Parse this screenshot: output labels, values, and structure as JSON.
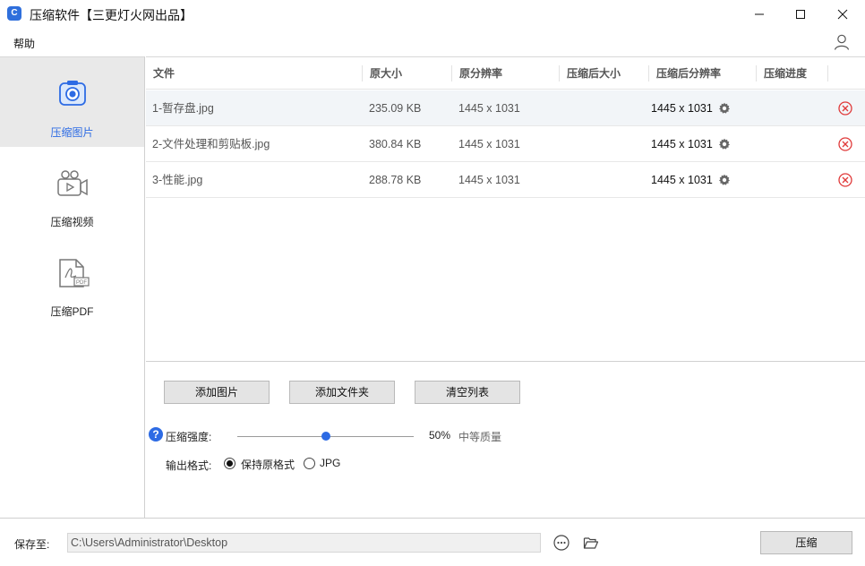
{
  "window": {
    "app_icon_letter": "C",
    "title": "压缩软件【三更灯火网出品】"
  },
  "menu": {
    "help": "帮助"
  },
  "sidebar": {
    "items": [
      {
        "label": "压缩图片",
        "icon": "image-compress-icon",
        "active": true
      },
      {
        "label": "压缩视频",
        "icon": "video-camera-icon",
        "active": false
      },
      {
        "label": "压缩PDF",
        "icon": "pdf-file-icon",
        "active": false
      }
    ]
  },
  "table": {
    "headers": [
      "文件",
      "原大小",
      "原分辨率",
      "压缩后大小",
      "压缩后分辨率",
      "压缩进度"
    ],
    "rows": [
      {
        "file": "1-暂存盘.jpg",
        "size": "235.09 KB",
        "resolution": "1445 x 1031",
        "compressed_size": "",
        "compressed_resolution": "1445 x 1031",
        "progress": ""
      },
      {
        "file": "2-文件处理和剪贴板.jpg",
        "size": "380.84 KB",
        "resolution": "1445 x 1031",
        "compressed_size": "",
        "compressed_resolution": "1445 x 1031",
        "progress": ""
      },
      {
        "file": "3-性能.jpg",
        "size": "288.78 KB",
        "resolution": "1445 x 1031",
        "compressed_size": "",
        "compressed_resolution": "1445 x 1031",
        "progress": ""
      }
    ]
  },
  "controls": {
    "add_image": "添加图片",
    "add_folder": "添加文件夹",
    "clear_list": "清空列表",
    "help_glyph": "?",
    "strength_label": "压缩强度:",
    "strength_value": "50%",
    "strength_percent": 50,
    "quality_label": "中等质量",
    "format_label": "输出格式:",
    "format_keep": "保持原格式",
    "format_jpg": "JPG",
    "format_selected": "keep"
  },
  "footer": {
    "save_label": "保存至:",
    "save_path": "C:\\Users\\Administrator\\Desktop",
    "compress": "压缩"
  },
  "colors": {
    "accent": "#2d6be4",
    "delete_red": "#e03a3a"
  }
}
